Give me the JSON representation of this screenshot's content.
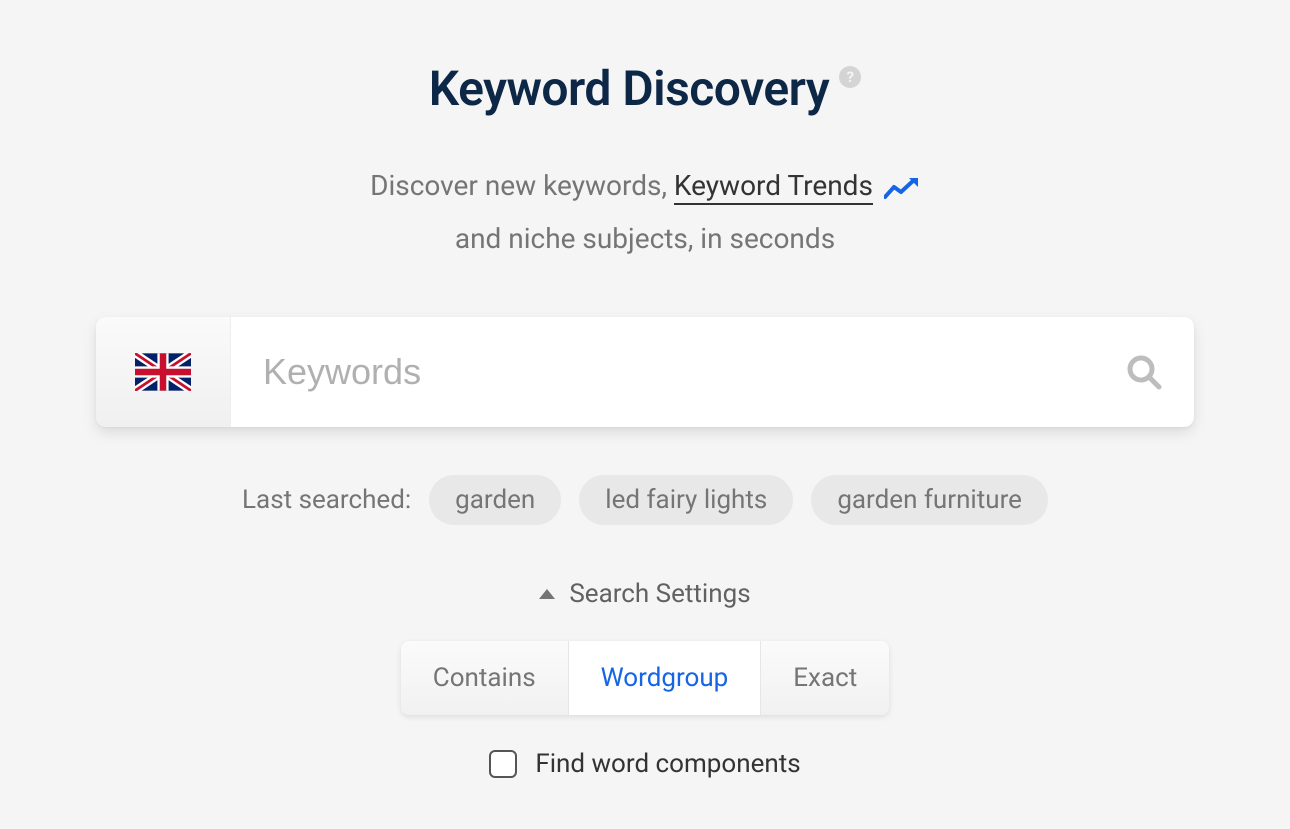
{
  "header": {
    "title": "Keyword Discovery",
    "help_glyph": "?"
  },
  "subtitle": {
    "part1": "Discover new keywords, ",
    "trends_link": "Keyword Trends",
    "part2": "and niche subjects, in seconds"
  },
  "search": {
    "placeholder": "Keywords",
    "value": "",
    "country_flag": "uk"
  },
  "last_searched": {
    "label": "Last searched:",
    "items": [
      "garden",
      "led fairy lights",
      "garden furniture"
    ]
  },
  "settings": {
    "toggle_label": "Search Settings",
    "expanded": true,
    "match_tabs": [
      {
        "label": "Contains",
        "active": false
      },
      {
        "label": "Wordgroup",
        "active": true
      },
      {
        "label": "Exact",
        "active": false
      }
    ],
    "find_components": {
      "label": "Find word components",
      "checked": false
    }
  },
  "colors": {
    "accent_blue": "#1565e6",
    "title_navy": "#0d2747"
  }
}
